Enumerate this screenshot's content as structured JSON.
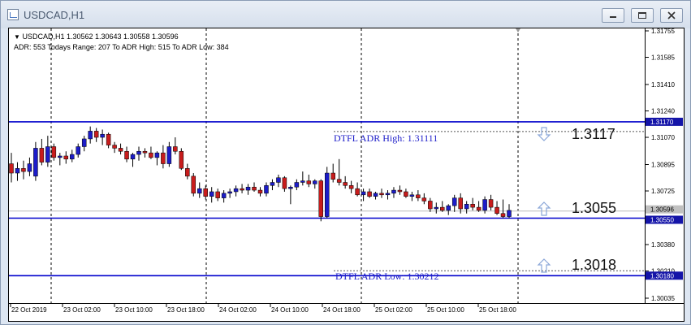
{
  "window": {
    "title": "USDCAD,H1",
    "buttons": [
      "minimize",
      "restore",
      "close"
    ]
  },
  "info": {
    "line1": "USDCAD,H1  1.30562 1.30643 1.30558 1.30596",
    "line2": "ADR: 553  Todays Range: 207  To ADR High: 515  To ADR Low: 384"
  },
  "labels": {
    "adr_high_text": "DTFL ADR High: 1.31111",
    "adr_low_text": "DTFL ADR Low: 1.30212",
    "big_upper": "1.3117",
    "big_middle": "1.3055",
    "big_lower": "1.3018"
  },
  "colors": {
    "bull": "#1c1cc8",
    "bear": "#c81c1c",
    "level_line": "#0000cc",
    "label_blue": "#1c1cc8",
    "arrow": "#8aa6d8",
    "price_tag_bg": "#1414a8"
  },
  "chart_data": {
    "type": "candlestick",
    "symbol": "USDCAD",
    "timeframe": "H1",
    "ylim": [
      1.30035,
      1.31755
    ],
    "y_ticks": [
      "1.31755",
      "1.31585",
      "1.31410",
      "1.31240",
      "1.31070",
      "1.30895",
      "1.30725",
      "1.30596",
      "1.30550",
      "1.30380",
      "1.30210",
      "1.30180",
      "1.30035"
    ],
    "x_ticks": [
      "22 Oct 2019",
      "23 Oct 02:00",
      "23 Oct 10:00",
      "23 Oct 18:00",
      "24 Oct 02:00",
      "24 Oct 10:00",
      "24 Oct 18:00",
      "25 Oct 02:00",
      "25 Oct 10:00",
      "25 Oct 18:00"
    ],
    "levels": [
      {
        "name": "upper",
        "value": 1.3117
      },
      {
        "name": "middle",
        "value": 1.3055
      },
      {
        "name": "lower",
        "value": 1.3018
      }
    ],
    "price_tags": [
      {
        "value": 1.3117,
        "text": "1.31170"
      },
      {
        "value": 1.30596,
        "text": "1.30596"
      },
      {
        "value": 1.3055,
        "text": "1.30550"
      },
      {
        "value": 1.3018,
        "text": "1.30180"
      }
    ],
    "candles": [
      [
        1.309,
        1.3097,
        1.3078,
        1.3084
      ],
      [
        1.3084,
        1.3091,
        1.3079,
        1.3087
      ],
      [
        1.3087,
        1.3092,
        1.308,
        1.3085
      ],
      [
        1.3085,
        1.3094,
        1.3082,
        1.309
      ],
      [
        1.3082,
        1.3104,
        1.3079,
        1.31
      ],
      [
        1.31,
        1.3106,
        1.3089,
        1.3091
      ],
      [
        1.3091,
        1.3108,
        1.3088,
        1.3101
      ],
      [
        1.3101,
        1.3103,
        1.3092,
        1.3094
      ],
      [
        1.3094,
        1.3097,
        1.3089,
        1.3095
      ],
      [
        1.3095,
        1.3098,
        1.309,
        1.3093
      ],
      [
        1.3093,
        1.3099,
        1.3091,
        1.3096
      ],
      [
        1.3096,
        1.3103,
        1.3094,
        1.3101
      ],
      [
        1.3101,
        1.3108,
        1.3098,
        1.3106
      ],
      [
        1.3106,
        1.3114,
        1.3103,
        1.3111
      ],
      [
        1.3111,
        1.3113,
        1.3104,
        1.3107
      ],
      [
        1.3107,
        1.3112,
        1.3102,
        1.3109
      ],
      [
        1.3109,
        1.311,
        1.31,
        1.3102
      ],
      [
        1.3102,
        1.3104,
        1.3097,
        1.31
      ],
      [
        1.31,
        1.3103,
        1.3096,
        1.3098
      ],
      [
        1.3098,
        1.3101,
        1.3091,
        1.3093
      ],
      [
        1.3093,
        1.3097,
        1.3088,
        1.3096
      ],
      [
        1.3096,
        1.3101,
        1.3092,
        1.3098
      ],
      [
        1.3098,
        1.31,
        1.3094,
        1.3097
      ],
      [
        1.3097,
        1.3101,
        1.3093,
        1.3094
      ],
      [
        1.3094,
        1.3098,
        1.3089,
        1.3097
      ],
      [
        1.3097,
        1.3102,
        1.3087,
        1.309
      ],
      [
        1.309,
        1.3104,
        1.3088,
        1.3101
      ],
      [
        1.3101,
        1.3107,
        1.3096,
        1.3098
      ],
      [
        1.3098,
        1.31,
        1.3086,
        1.3087
      ],
      [
        1.3087,
        1.309,
        1.308,
        1.3082
      ],
      [
        1.3082,
        1.3084,
        1.3069,
        1.3071
      ],
      [
        1.3071,
        1.3078,
        1.3068,
        1.3074
      ],
      [
        1.3074,
        1.3076,
        1.3067,
        1.3069
      ],
      [
        1.3069,
        1.3075,
        1.3065,
        1.3072
      ],
      [
        1.3072,
        1.3074,
        1.3066,
        1.3068
      ],
      [
        1.3068,
        1.3073,
        1.3065,
        1.3071
      ],
      [
        1.3071,
        1.3074,
        1.3068,
        1.3072
      ],
      [
        1.3072,
        1.3076,
        1.3069,
        1.3074
      ],
      [
        1.3074,
        1.3077,
        1.3071,
        1.3073
      ],
      [
        1.3073,
        1.3077,
        1.307,
        1.3075
      ],
      [
        1.3075,
        1.3078,
        1.3072,
        1.3073
      ],
      [
        1.3073,
        1.3075,
        1.3069,
        1.3071
      ],
      [
        1.3071,
        1.3078,
        1.3069,
        1.3076
      ],
      [
        1.3076,
        1.308,
        1.3073,
        1.3078
      ],
      [
        1.3078,
        1.3083,
        1.3075,
        1.3081
      ],
      [
        1.3081,
        1.3082,
        1.3072,
        1.3074
      ],
      [
        1.3074,
        1.3076,
        1.3064,
        1.3075
      ],
      [
        1.3075,
        1.308,
        1.3073,
        1.3078
      ],
      [
        1.3078,
        1.3085,
        1.3076,
        1.3079
      ],
      [
        1.3079,
        1.3083,
        1.3075,
        1.3077
      ],
      [
        1.3077,
        1.308,
        1.3074,
        1.3079
      ],
      [
        1.3079,
        1.308,
        1.3053,
        1.3056
      ],
      [
        1.3056,
        1.3088,
        1.3055,
        1.3084
      ],
      [
        1.3084,
        1.309,
        1.3078,
        1.308
      ],
      [
        1.308,
        1.3093,
        1.3076,
        1.3078
      ],
      [
        1.3078,
        1.3082,
        1.3074,
        1.3076
      ],
      [
        1.3076,
        1.3079,
        1.3071,
        1.3074
      ],
      [
        1.3074,
        1.3078,
        1.3069,
        1.307
      ],
      [
        1.307,
        1.3074,
        1.3066,
        1.3072
      ],
      [
        1.3072,
        1.3074,
        1.3068,
        1.3069
      ],
      [
        1.3069,
        1.3072,
        1.3067,
        1.3071
      ],
      [
        1.3071,
        1.3074,
        1.3068,
        1.307
      ],
      [
        1.307,
        1.3073,
        1.3067,
        1.3071
      ],
      [
        1.3071,
        1.3075,
        1.3068,
        1.3073
      ],
      [
        1.3073,
        1.3076,
        1.307,
        1.3072
      ],
      [
        1.3072,
        1.3074,
        1.3068,
        1.3069
      ],
      [
        1.3069,
        1.3072,
        1.3066,
        1.307
      ],
      [
        1.307,
        1.3073,
        1.3066,
        1.3068
      ],
      [
        1.3068,
        1.3071,
        1.3064,
        1.3066
      ],
      [
        1.3066,
        1.3068,
        1.3059,
        1.3061
      ],
      [
        1.3061,
        1.3065,
        1.3058,
        1.3062
      ],
      [
        1.3062,
        1.3066,
        1.3059,
        1.306
      ],
      [
        1.306,
        1.3064,
        1.3057,
        1.3063
      ],
      [
        1.3063,
        1.307,
        1.3059,
        1.3068
      ],
      [
        1.3068,
        1.3071,
        1.3058,
        1.3061
      ],
      [
        1.3061,
        1.3066,
        1.3058,
        1.3064
      ],
      [
        1.3064,
        1.3068,
        1.306,
        1.3062
      ],
      [
        1.3062,
        1.3066,
        1.3059,
        1.306
      ],
      [
        1.306,
        1.3069,
        1.3058,
        1.3067
      ],
      [
        1.3067,
        1.307,
        1.306,
        1.3062
      ],
      [
        1.3062,
        1.3066,
        1.3057,
        1.3058
      ],
      [
        1.3058,
        1.3067,
        1.3055,
        1.3056
      ],
      [
        1.3056,
        1.3064,
        1.3055,
        1.306
      ]
    ]
  }
}
